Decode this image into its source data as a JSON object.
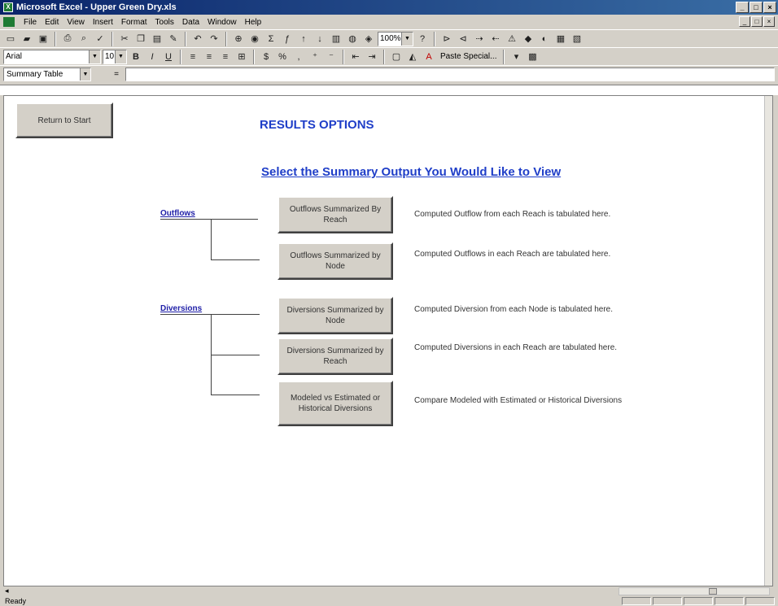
{
  "window": {
    "title": "Microsoft Excel - Upper Green Dry.xls",
    "app_icon": "excel-icon",
    "controls": [
      "_",
      "□",
      "×"
    ]
  },
  "menu": {
    "items": [
      "File",
      "Edit",
      "View",
      "Insert",
      "Format",
      "Tools",
      "Data",
      "Window",
      "Help"
    ],
    "doc_controls": [
      "_",
      "□",
      "×"
    ]
  },
  "toolbar1": {
    "zoom": "100%"
  },
  "toolbar2": {
    "font": "Arial",
    "size": "10",
    "paste_special": "Paste Special..."
  },
  "formula_bar": {
    "name_box": "Summary Table",
    "fx": "="
  },
  "sheet": {
    "return_button": "Return to Start",
    "title": "RESULTS OPTIONS",
    "subtitle": "Select the Summary Output You Would Like to View",
    "outflows": {
      "label": "Outflows",
      "options": [
        {
          "button": "Outflows Summarized By Reach",
          "desc": "Computed Outflow from each Reach is tabulated here."
        },
        {
          "button": "Outflows Summarized by Node",
          "desc": "Computed Outflows in each Reach are tabulated here."
        }
      ]
    },
    "diversions": {
      "label": "Diversions",
      "options": [
        {
          "button": "Diversions Summarized by Node",
          "desc": "Computed Diversion from each Node is tabulated here."
        },
        {
          "button": "Diversions Summarized by Reach",
          "desc": "Computed Diversions in each Reach are tabulated here."
        },
        {
          "button": "Modeled vs Estimated or Historical Diversions",
          "desc": "Compare Modeled with Estimated or Historical Diversions"
        }
      ]
    }
  },
  "status": {
    "text": "Ready"
  }
}
